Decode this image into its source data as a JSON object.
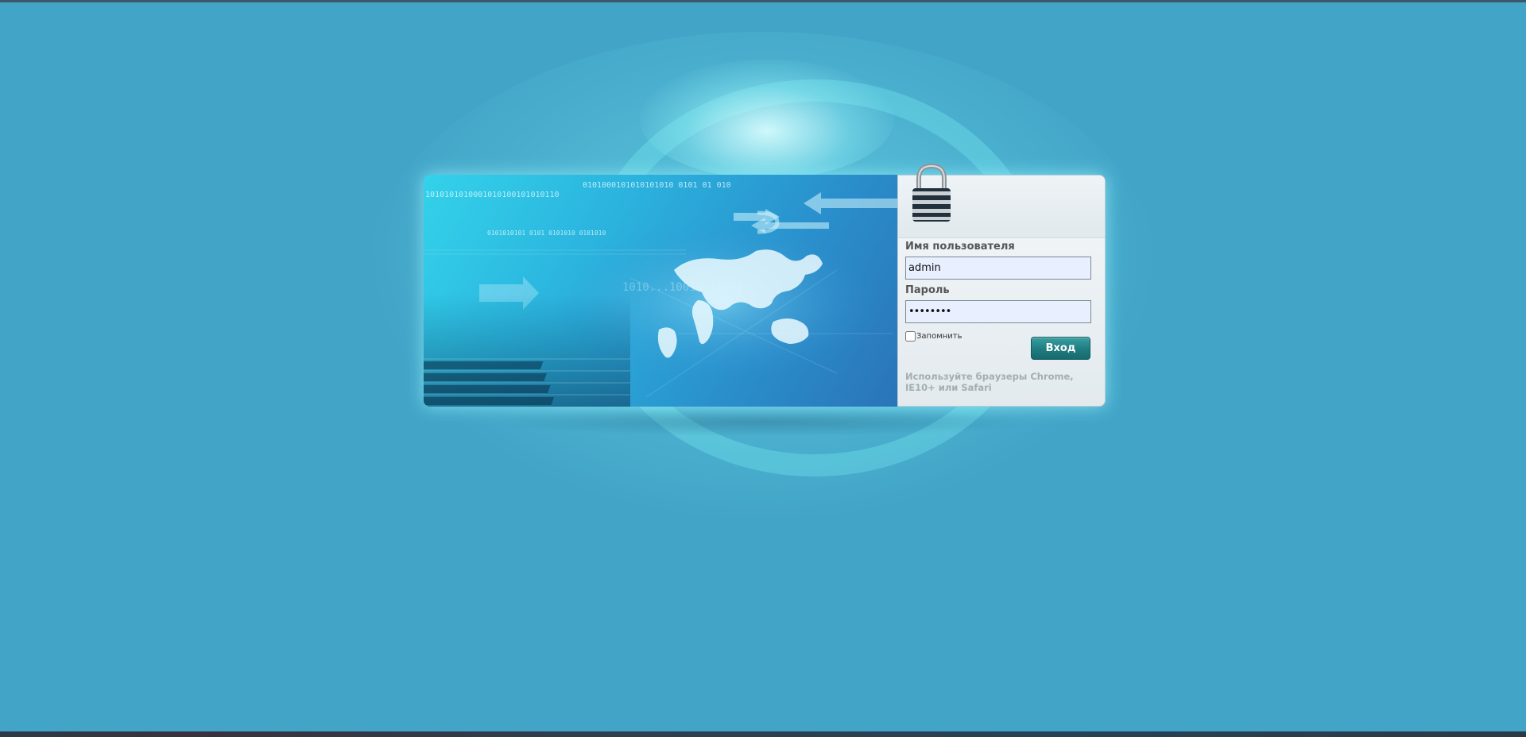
{
  "banner": {
    "binary_lines": [
      "0101000101010101010     0101    01 010",
      "1010101010001010100101010110",
      "0101010101 0101 0101010 0101010",
      "1010...10010   1010Y"
    ]
  },
  "login": {
    "username_label": "Имя пользователя",
    "username_value": "admin",
    "password_label": "Пароль",
    "password_value": "••••••••",
    "remember_label": "Запомнить",
    "submit_label": "Вход",
    "browser_hint": "Используйте браузеры Chrome, IE10+ или Safari"
  },
  "icons": {
    "lock": "padlock-icon"
  },
  "colors": {
    "background": "#42a5c8",
    "button": "#1f7c80",
    "input_bg": "#e8efff"
  }
}
